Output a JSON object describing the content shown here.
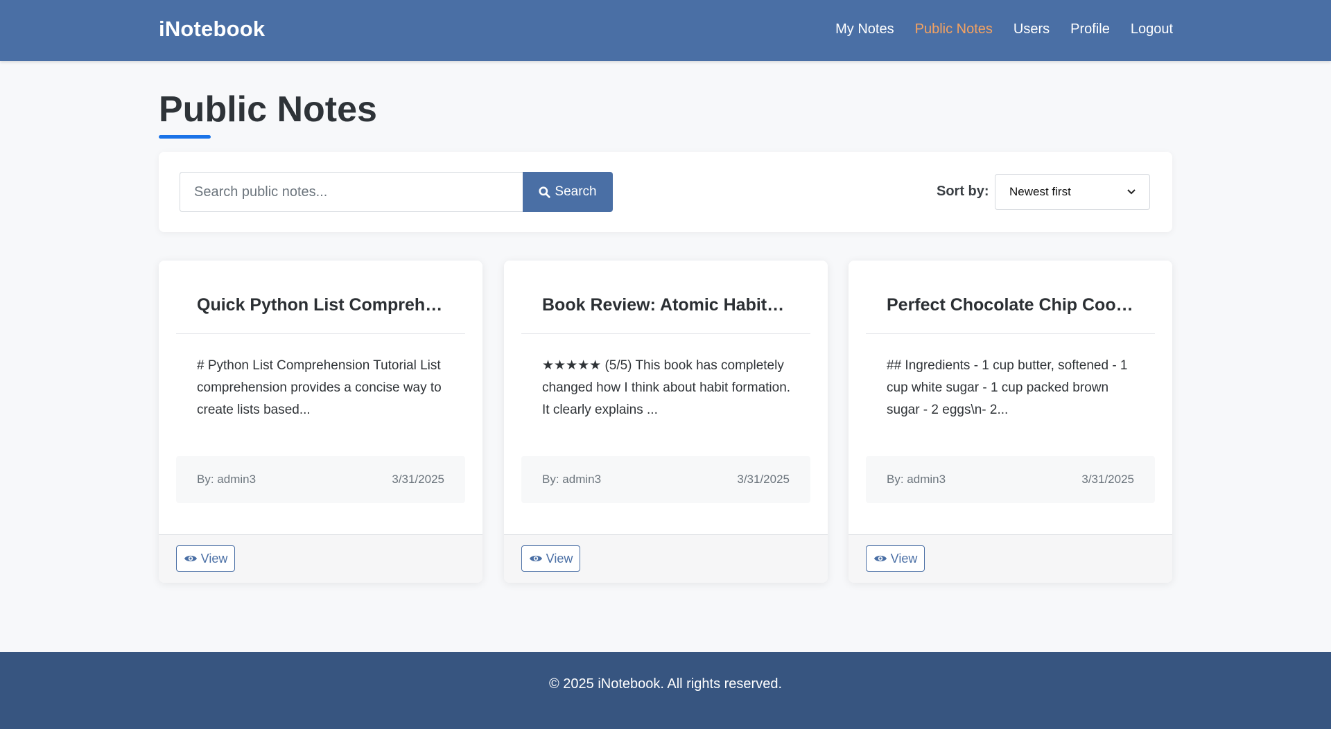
{
  "app": {
    "brand": "iNotebook"
  },
  "nav": {
    "items": [
      {
        "label": "My Notes",
        "active": false
      },
      {
        "label": "Public Notes",
        "active": true
      },
      {
        "label": "Users",
        "active": false
      },
      {
        "label": "Profile",
        "active": false
      },
      {
        "label": "Logout",
        "active": false
      }
    ]
  },
  "page": {
    "title": "Public Notes"
  },
  "search": {
    "placeholder": "Search public notes...",
    "value": "",
    "button_label": "Search",
    "button_icon": "search-icon",
    "sort_label": "Sort by:",
    "sort_selected": "Newest first"
  },
  "notes": [
    {
      "title": "Quick Python List Comprehen...",
      "excerpt": "# Python List Comprehension Tutorial List comprehension provides a concise way to create lists based...",
      "author": "By: admin3",
      "date": "3/31/2025",
      "view_label": "View"
    },
    {
      "title": "Book Review: Atomic Habits b...",
      "excerpt": "★★★★★ (5/5) This book has completely changed how I think about habit formation. It clearly explains ...",
      "author": "By: admin3",
      "date": "3/31/2025",
      "view_label": "View"
    },
    {
      "title": "Perfect Chocolate Chip Cookies",
      "excerpt": "## Ingredients - 1 cup butter, softened - 1 cup white sugar - 1 cup packed brown sugar - 2 eggs\\n- 2...",
      "author": "By: admin3",
      "date": "3/31/2025",
      "view_label": "View"
    }
  ],
  "footer": {
    "text": "© 2025 iNotebook. All rights reserved."
  },
  "colors": {
    "primary": "#4a6fa5",
    "active_nav": "#f4a261",
    "footer_bg": "#375580",
    "accent_underline": "#1a73e8"
  }
}
